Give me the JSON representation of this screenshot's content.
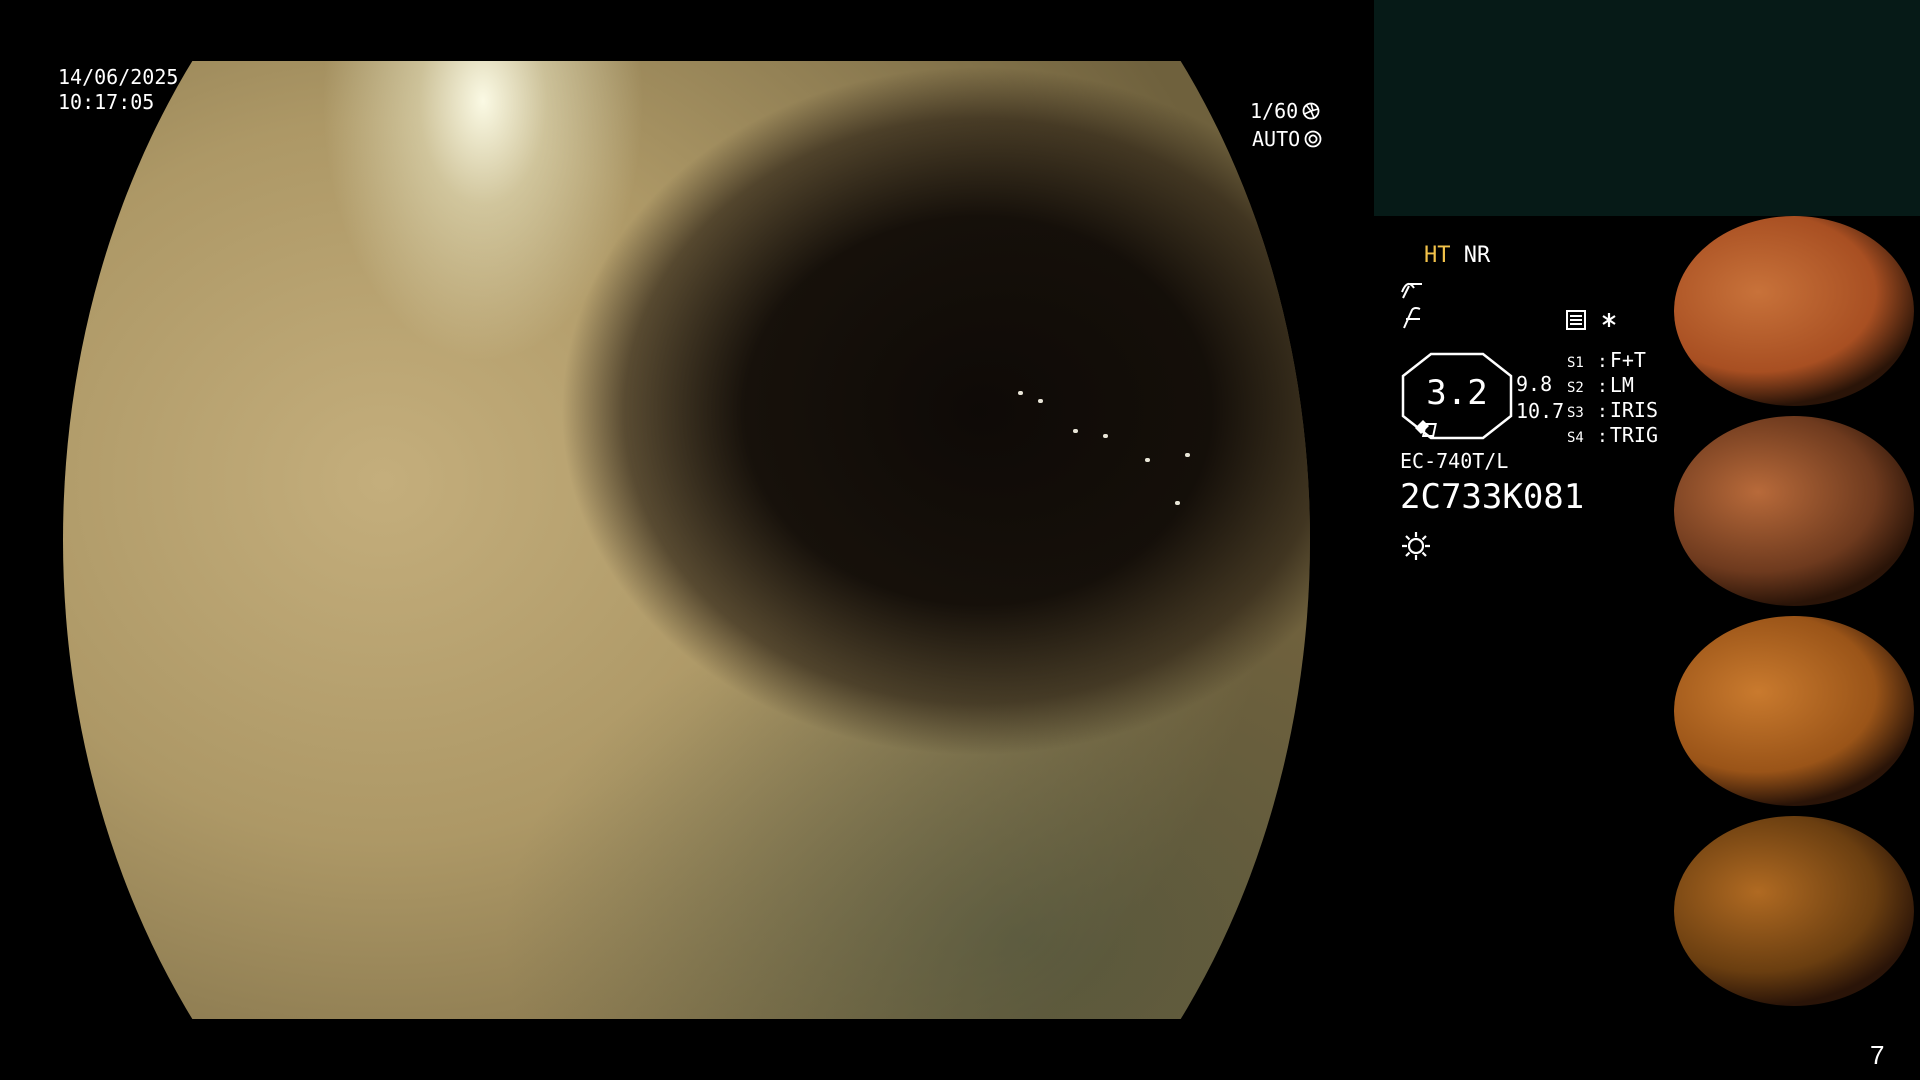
{
  "overlay": {
    "date": "14/06/2025",
    "time": "10:17:05",
    "shutter": "1/60",
    "iris_mode": "AUTO"
  },
  "panel": {
    "ht": "HT",
    "nr": "NR",
    "zoom_value": "3.2",
    "value_top": "9.8",
    "value_bottom": "10.7",
    "scope_model": "EC-740T/L",
    "scope_serial": "2C733K081",
    "switches": [
      {
        "key": "S1",
        "value": "F+T"
      },
      {
        "key": "S2",
        "value": "LM"
      },
      {
        "key": "S3",
        "value": "IRIS"
      },
      {
        "key": "S4",
        "value": "TRIG"
      }
    ]
  },
  "thumbnails": [
    {
      "name": "capture-1",
      "colors": [
        "#c8723a",
        "#a84f22"
      ]
    },
    {
      "name": "capture-2",
      "colors": [
        "#b86a3a",
        "#6e3a1e"
      ]
    },
    {
      "name": "capture-3",
      "colors": [
        "#c97a2e",
        "#9a5418"
      ]
    },
    {
      "name": "capture-4",
      "colors": [
        "#b06a22",
        "#6a3e10"
      ]
    }
  ],
  "page_number": "7",
  "colors": {
    "accent_yellow": "#f2c24a",
    "mask_box": "#061a17"
  }
}
